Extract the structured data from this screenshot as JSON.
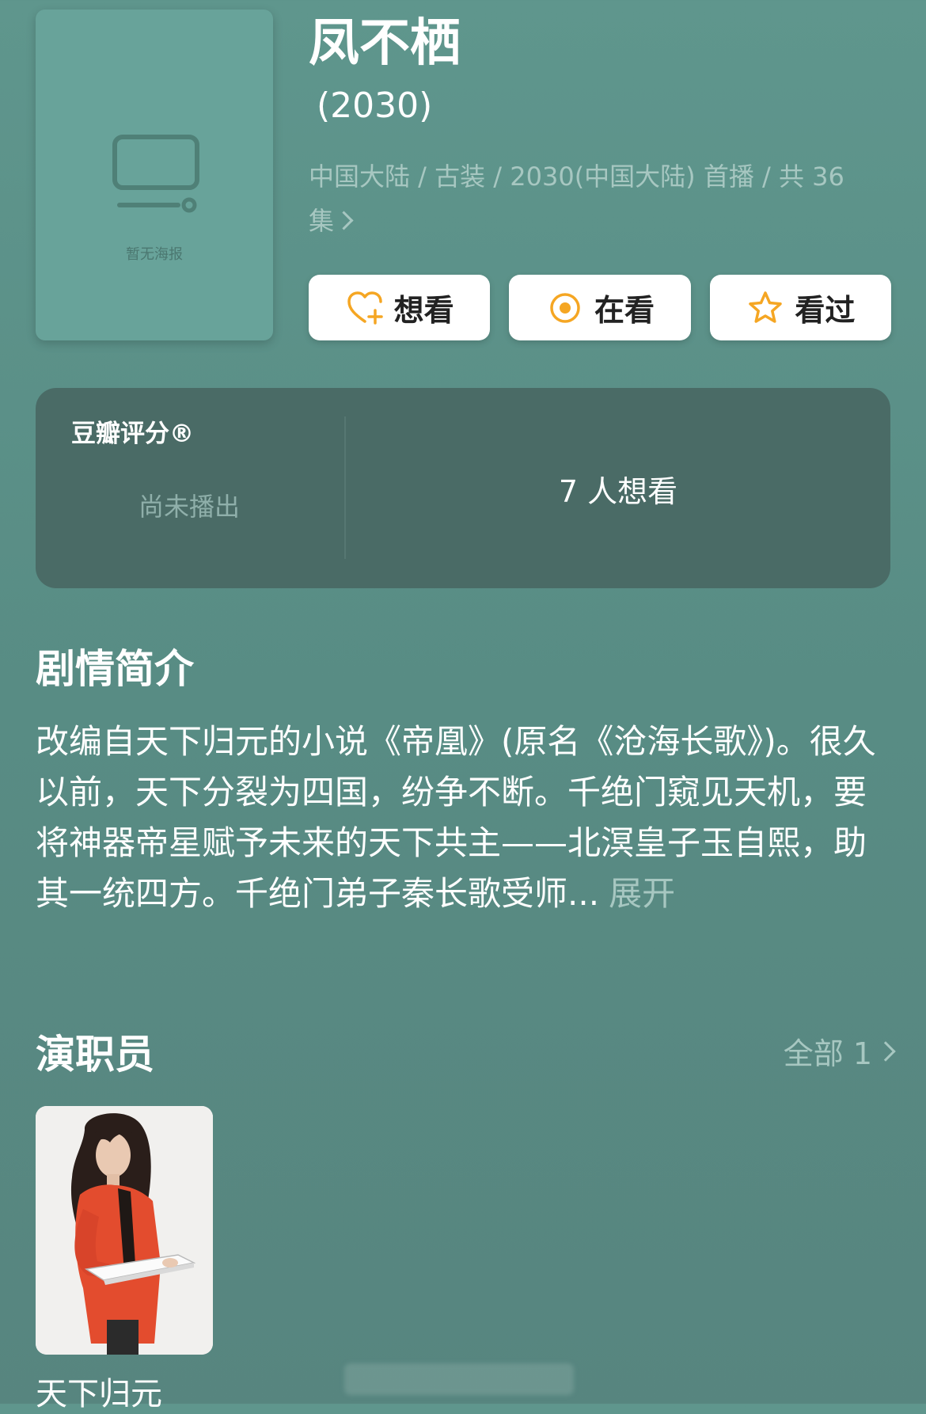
{
  "poster": {
    "placeholder_text": "暂无海报",
    "icon": "tv-icon"
  },
  "title": "凤不栖",
  "year": "(2030)",
  "meta": "中国大陆 / 古装 / 2030(中国大陆) 首播 / 共 36 集",
  "actions": [
    {
      "label": "想看",
      "icon": "heart-plus-icon"
    },
    {
      "label": "在看",
      "icon": "target-icon"
    },
    {
      "label": "看过",
      "icon": "star-icon"
    }
  ],
  "rating": {
    "label": "豆瓣评分®",
    "status": "尚未播出",
    "want_count": "7 人想看"
  },
  "synopsis": {
    "heading": "剧情简介",
    "text": "改编自天下归元的小说《帝凰》(原名《沧海长歌》)。很久以前，天下分裂为四国，纷争不断。千绝门窥见天机，要将神器帝星赋予未来的天下共主——北溟皇子玉自熙，助其一统四方。千绝门弟子秦长歌受师...",
    "expand": "展开"
  },
  "cast": {
    "heading": "演职员",
    "all_label": "全部 1",
    "members": [
      {
        "name": "天下归元"
      }
    ]
  },
  "colors": {
    "background": "#5f968d",
    "accent": "#f5a623",
    "card": "#4a6b66"
  }
}
